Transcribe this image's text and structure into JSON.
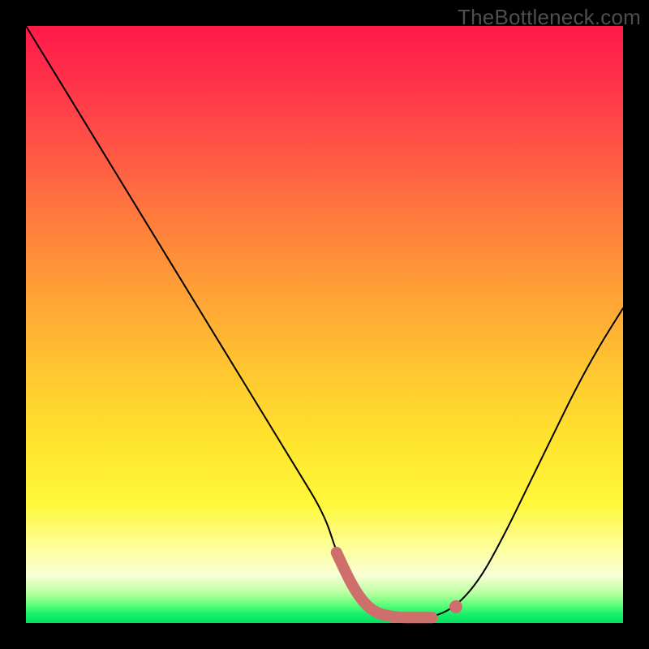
{
  "watermark": "TheBottleneck.com",
  "colors": {
    "frame": "#000000",
    "curve": "#000000",
    "highlight": "#cf6f6c",
    "gradient_top": "#ff1a4a",
    "gradient_bottom": "#00e060"
  },
  "chart_data": {
    "type": "line",
    "title": "",
    "xlabel": "",
    "ylabel": "",
    "xlim": [
      0,
      100
    ],
    "ylim": [
      0,
      110
    ],
    "grid": false,
    "legend": false,
    "annotations": [
      "TheBottleneck.com"
    ],
    "series": [
      {
        "name": "bottleneck-curve",
        "x": [
          0,
          5,
          10,
          15,
          20,
          25,
          30,
          35,
          40,
          45,
          50,
          52,
          55,
          58,
          62,
          65,
          68,
          72,
          76,
          80,
          84,
          88,
          92,
          96,
          100
        ],
        "y": [
          110,
          101,
          92,
          83,
          74,
          65,
          56,
          47,
          38,
          29,
          20,
          13,
          6,
          2,
          1,
          1,
          1,
          3,
          8,
          16,
          25,
          34,
          43,
          51,
          58
        ]
      }
    ],
    "highlight": {
      "name": "optimal-region",
      "x": [
        52,
        55,
        58,
        62,
        65,
        68
      ],
      "y": [
        13,
        6,
        2,
        1,
        1,
        1
      ],
      "marker_at": {
        "x": 72,
        "y": 3
      }
    }
  }
}
